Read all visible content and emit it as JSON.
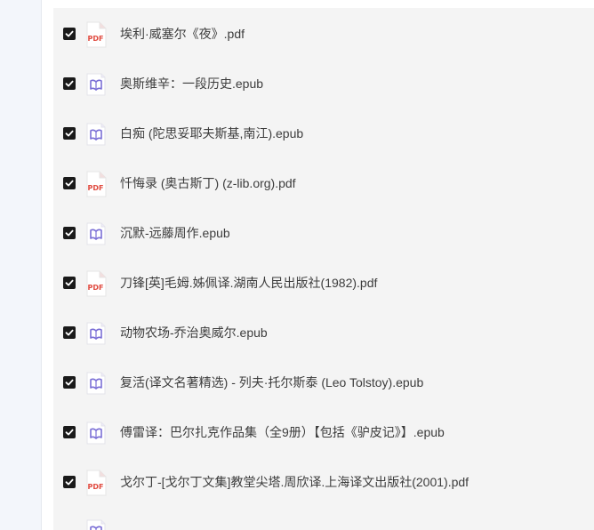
{
  "files": [
    {
      "name": "埃利·威塞尔《夜》.pdf",
      "type": "pdf",
      "checked": true
    },
    {
      "name": "奥斯维辛：一段历史.epub",
      "type": "epub",
      "checked": true
    },
    {
      "name": "白痴 (陀思妥耶夫斯基,南江).epub",
      "type": "epub",
      "checked": true
    },
    {
      "name": "忏悔录 (奥古斯丁) (z-lib.org).pdf",
      "type": "pdf",
      "checked": true
    },
    {
      "name": "沉默-远藤周作.epub",
      "type": "epub",
      "checked": true
    },
    {
      "name": "刀锋[英]毛姆.姊佩译.湖南人民出版社(1982).pdf",
      "type": "pdf",
      "checked": true
    },
    {
      "name": "动物农场-乔治奥威尔.epub",
      "type": "epub",
      "checked": true
    },
    {
      "name": "复活(译文名著精选) - 列夫·托尔斯泰 (Leo Tolstoy).epub",
      "type": "epub",
      "checked": true
    },
    {
      "name": "傅雷译：巴尔扎克作品集（全9册）【包括《驴皮记》】.epub",
      "type": "epub",
      "checked": true
    },
    {
      "name": "戈尔丁-[戈尔丁文集]教堂尖塔.周欣译.上海译文出版社(2001).pdf",
      "type": "pdf",
      "checked": true
    }
  ],
  "icons": {
    "pdf_label": "PDF",
    "pdf_color": "#e04a3f",
    "epub_color": "#7b6fd6",
    "check_color": "#1a1a1a"
  }
}
